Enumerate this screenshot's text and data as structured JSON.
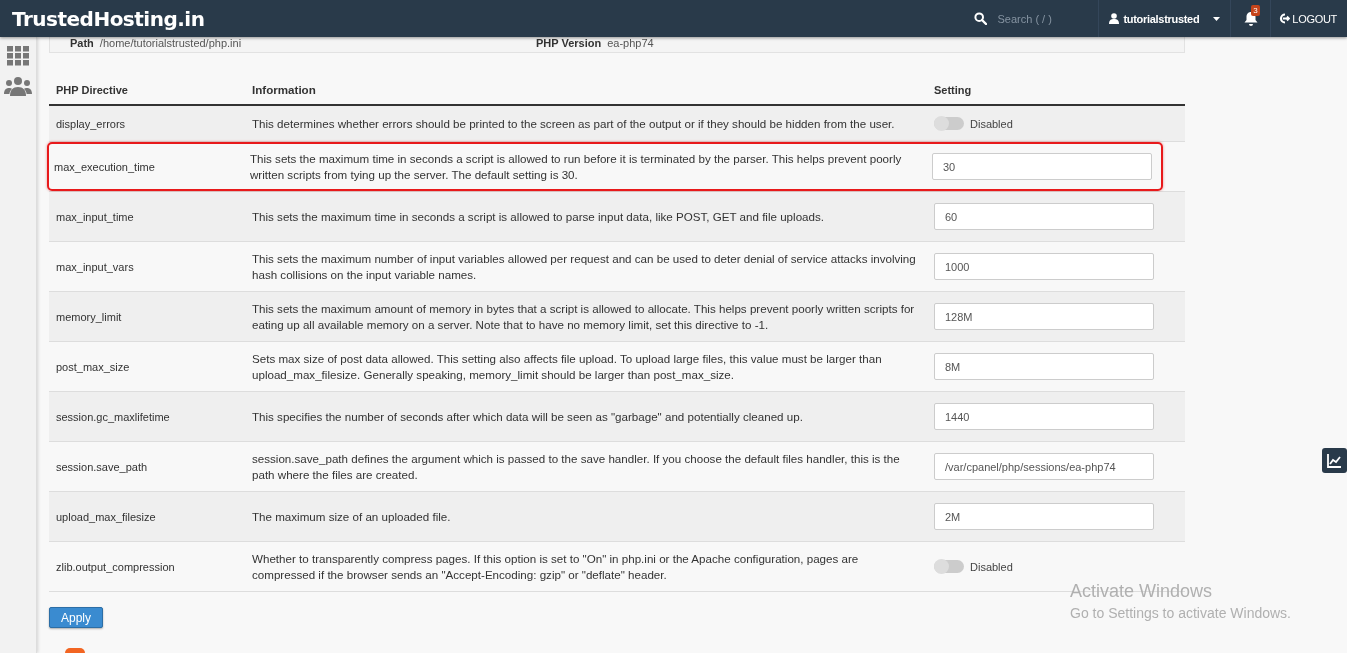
{
  "topbar": {
    "brand": "TrustedHosting.in",
    "search_placeholder": "Search ( / )",
    "user": "tutorialstrusted",
    "notifications": "3",
    "logout": "LOGOUT"
  },
  "info_panel": {
    "path_label": "Path",
    "path": "/home/tutorialstrusted/php.ini",
    "version_label": "PHP Version",
    "version": "ea-php74"
  },
  "table": {
    "columns": [
      "PHP Directive",
      "Information",
      "Setting"
    ],
    "rows": [
      {
        "directive": "display_errors",
        "information": "This determines whether errors should be printed to the screen as part of the output or if they should be hidden from the user.",
        "kind": "toggle",
        "on": false,
        "value": "Disabled",
        "highlighted": false
      },
      {
        "directive": "max_execution_time",
        "information": "This sets the maximum time in seconds a script is allowed to run before it is terminated by the parser. This helps prevent poorly written scripts from tying up the server. The default setting is 30.",
        "kind": "text",
        "value": "30",
        "highlighted": true
      },
      {
        "directive": "max_input_time",
        "information": "This sets the maximum time in seconds a script is allowed to parse input data, like POST, GET and file uploads.",
        "kind": "text",
        "value": "60",
        "highlighted": false
      },
      {
        "directive": "max_input_vars",
        "information": "This sets the maximum number of input variables allowed per request and can be used to deter denial of service attacks involving hash collisions on the input variable names.",
        "kind": "text",
        "value": "1000",
        "highlighted": false
      },
      {
        "directive": "memory_limit",
        "information": "This sets the maximum amount of memory in bytes that a script is allowed to allocate. This helps prevent poorly written scripts for eating up all available memory on a server. Note that to have no memory limit, set this directive to -1.",
        "kind": "text",
        "value": "128M",
        "highlighted": false
      },
      {
        "directive": "post_max_size",
        "information": "Sets max size of post data allowed. This setting also affects file upload. To upload large files, this value must be larger than upload_max_filesize. Generally speaking, memory_limit should be larger than post_max_size.",
        "kind": "text",
        "value": "8M",
        "highlighted": false
      },
      {
        "directive": "session.gc_maxlifetime",
        "information": "This specifies the number of seconds after which data will be seen as \"garbage\" and potentially cleaned up.",
        "kind": "text",
        "value": "1440",
        "highlighted": false
      },
      {
        "directive": "session.save_path",
        "information": "session.save_path defines the argument which is passed to the save handler. If you choose the default files handler, this is the path where the files are created.",
        "kind": "text",
        "value": "/var/cpanel/php/sessions/ea-php74",
        "highlighted": false
      },
      {
        "directive": "upload_max_filesize",
        "information": "The maximum size of an uploaded file.",
        "kind": "text",
        "value": "2M",
        "highlighted": false
      },
      {
        "directive": "zlib.output_compression",
        "information": "Whether to transparently compress pages. If this option is set to \"On\" in php.ini or the Apache configuration, pages are compressed if the browser sends an \"Accept-Encoding: gzip\" or \"deflate\" header.",
        "kind": "toggle",
        "on": false,
        "value": "Disabled",
        "highlighted": false
      }
    ]
  },
  "apply_button": "Apply",
  "os_notice": {
    "title": "Activate Windows",
    "subtitle": "Go to Settings to activate Windows."
  }
}
